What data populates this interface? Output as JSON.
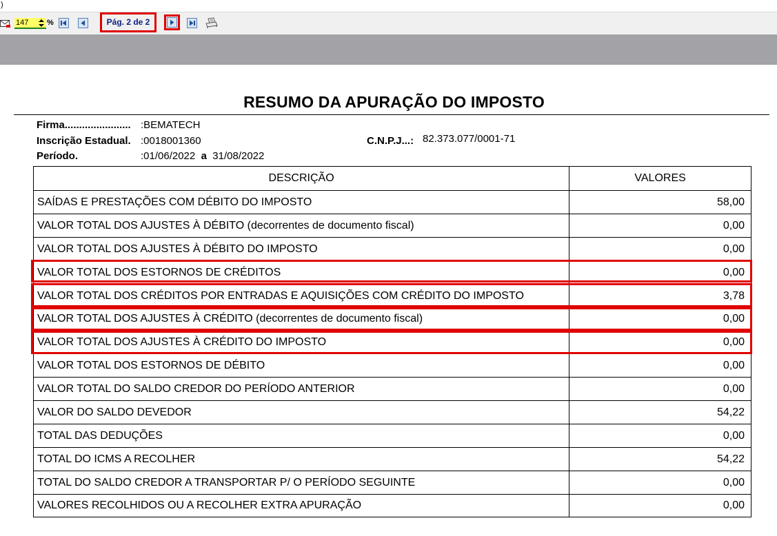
{
  "top_strip": {
    "text": ")"
  },
  "toolbar": {
    "zoom_value": "147",
    "zoom_unit": "%",
    "page_label": "Pág. 2 de 2",
    "icons": [
      "mail-icon",
      "zoom-spinner-icon",
      "first-page-icon",
      "previous-page-icon",
      "next-page-icon",
      "last-page-icon",
      "print-icon"
    ]
  },
  "report": {
    "title": "RESUMO DA APURAÇÃO DO IMPOSTO",
    "firma_label": "Firma.......................",
    "firma_value": "BEMATECH",
    "ie_label": "Inscrição Estadual.",
    "ie_value": "0018001360",
    "cnpj_label": "C.N.P.J...:",
    "cnpj_value": "82.373.077/0001-71",
    "periodo_label": "Período.",
    "periodo_start": "01/06/2022",
    "periodo_sep": "a",
    "periodo_end": "31/08/2022",
    "colon": ":",
    "columns": [
      "DESCRIÇÃO",
      "VALORES"
    ],
    "rows": [
      {
        "desc": "SAÍDAS E PRESTAÇÕES COM DÉBITO DO IMPOSTO",
        "value": "58,00"
      },
      {
        "desc": "VALOR TOTAL DOS AJUSTES À DÉBITO (decorrentes de documento fiscal)",
        "value": "0,00"
      },
      {
        "desc": "VALOR TOTAL DOS AJUSTES À DÉBITO DO IMPOSTO",
        "value": "0,00"
      },
      {
        "desc": "VALOR TOTAL DOS ESTORNOS DE CRÉDITOS",
        "value": "0,00"
      },
      {
        "desc": "VALOR TOTAL DOS CRÉDITOS POR ENTRADAS E AQUISIÇÕES COM CRÉDITO DO IMPOSTO",
        "value": "3,78"
      },
      {
        "desc": "VALOR TOTAL DOS AJUSTES À CRÉDITO (decorrentes de documento fiscal)",
        "value": "0,00"
      },
      {
        "desc": "VALOR TOTAL DOS AJUSTES À CRÉDITO DO IMPOSTO",
        "value": "0,00"
      },
      {
        "desc": "VALOR TOTAL DOS ESTORNOS DE DÉBITO",
        "value": "0,00"
      },
      {
        "desc": "VALOR TOTAL DO SALDO CREDOR DO PERÍODO ANTERIOR",
        "value": "0,00"
      },
      {
        "desc": "VALOR DO SALDO DEVEDOR",
        "value": "54,22"
      },
      {
        "desc": "TOTAL DAS DEDUÇÕES",
        "value": "0,00"
      },
      {
        "desc": "TOTAL DO ICMS A RECOLHER",
        "value": "54,22"
      },
      {
        "desc": "TOTAL DO SALDO CREDOR A TRANSPORTAR P/ O PERÍODO SEGUINTE",
        "value": "0,00"
      },
      {
        "desc": "VALORES  RECOLHIDOS OU A RECOLHER EXTRA APURAÇÃO",
        "value": "0,00"
      }
    ]
  },
  "colors": {
    "highlight": "#e00000",
    "page_label_text": "#0b1e80",
    "zoom_bg": "#ffff66",
    "gray_band": "#a3a2a6"
  }
}
